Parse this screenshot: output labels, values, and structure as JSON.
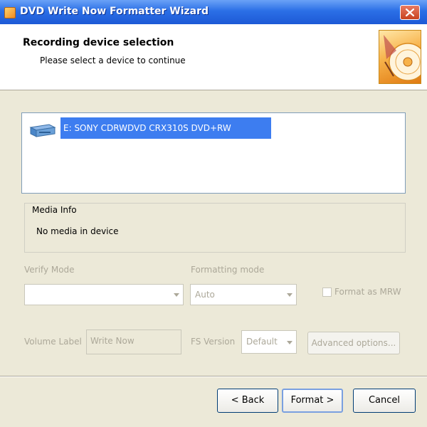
{
  "window": {
    "title": "DVD Write Now Formatter Wizard",
    "close_icon": "close-icon"
  },
  "header": {
    "title": "Recording device selection",
    "subtitle": "Please select a device to continue"
  },
  "devices": [
    {
      "label": "E:  SONY    CDRWDVD CRX310S  DVD+RW",
      "icon": "optical-drive-icon",
      "selected": true
    }
  ],
  "media_info": {
    "title": "Media Info",
    "status": "No media in device"
  },
  "verify": {
    "label": "Verify Mode",
    "value": ""
  },
  "formatting": {
    "label": "Formatting mode",
    "value": "Auto"
  },
  "mrw": {
    "label": "Format as MRW",
    "checked": false
  },
  "volume": {
    "label": "Volume Label",
    "value": "Write Now"
  },
  "fs": {
    "label": "FS Version",
    "value": "Default"
  },
  "advanced_label": "Advanced options...",
  "buttons": {
    "back": "< Back",
    "format": "Format >",
    "cancel": "Cancel"
  },
  "colors": {
    "titlebar": "#2b6fe6",
    "selection": "#3d7df0",
    "disabled_text": "#aca899",
    "dialog_bg": "#ece9d8"
  }
}
